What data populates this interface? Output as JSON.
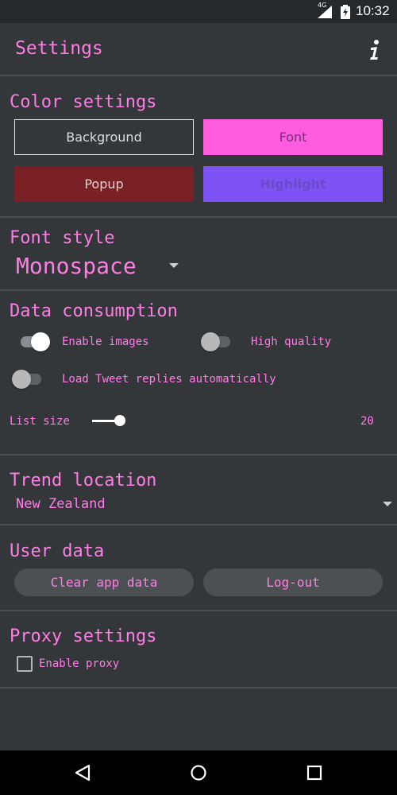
{
  "status_bar": {
    "network": "4G",
    "time": "10:32"
  },
  "app_bar": {
    "title": "Settings",
    "info_icon": "info-icon"
  },
  "color_settings": {
    "title": "Color settings",
    "buttons": [
      {
        "label": "Background",
        "color": "#33373a"
      },
      {
        "label": "Font",
        "color": "#ff5ce0"
      },
      {
        "label": "Popup",
        "color": "#7a2125"
      },
      {
        "label": "Highlight",
        "color": "#7d53f5"
      }
    ]
  },
  "font_style": {
    "title": "Font style",
    "selected": "Monospace"
  },
  "data_consumption": {
    "title": "Data consumption",
    "enable_images": {
      "label": "Enable images",
      "checked": true
    },
    "high_quality": {
      "label": "High quality",
      "checked": false
    },
    "load_replies": {
      "label": "Load Tweet replies automatically",
      "checked": false
    },
    "list_size": {
      "label": "List size",
      "value": "20"
    }
  },
  "trend_location": {
    "title": "Trend location",
    "selected": "New Zealand"
  },
  "user_data": {
    "title": "User data",
    "clear_label": "Clear app data",
    "logout_label": "Log-out"
  },
  "proxy_settings": {
    "title": "Proxy settings",
    "enable_proxy": {
      "label": "Enable proxy",
      "checked": false
    }
  },
  "colors": {
    "accent": "#ff7de4",
    "background": "#33373a",
    "divider": "#4a4e51"
  }
}
